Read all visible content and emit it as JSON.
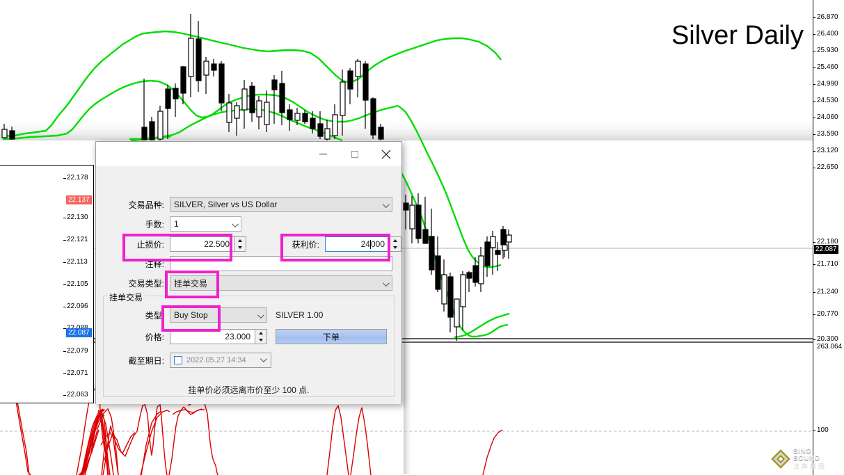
{
  "chart": {
    "title": "Silver Daily",
    "symbol_name": "SILVER",
    "current_price_label": "22.087",
    "price_scale_labels": [
      "26.870",
      "26.400",
      "25.930",
      "25.460",
      "24.990",
      "24.530",
      "24.060",
      "23.590",
      "23.120",
      "22.650",
      "22.180",
      "21.710",
      "21.240",
      "20.770",
      "20.300"
    ],
    "indicator_scale_labels": [
      "263.064",
      "100"
    ],
    "tick_panel": {
      "labels": [
        "22.178",
        "22.130",
        "22.121",
        "22.113",
        "22.105",
        "22.096",
        "22.088",
        "22.079",
        "22.071",
        "22.063"
      ],
      "ask_badge": "22.137",
      "bid_badge": "22.087",
      "ask_color": "#f4675f",
      "bid_color": "#1a72e8"
    },
    "colors": {
      "bollinger": "#00dd00",
      "oscillator": "#dd0000",
      "candle_outline": "#000000"
    }
  },
  "logo": {
    "name_en": "SINO SOUND",
    "name_cn": "汉声集团"
  },
  "dialog": {
    "title": "",
    "titlebar": {
      "minimize": "minimize",
      "maximize": "maximize",
      "close": "close"
    },
    "fields": {
      "symbol_label": "交易品种:",
      "symbol_value": "SILVER, Silver vs US Dollar",
      "volume_label": "手数:",
      "volume_value": "1",
      "stoploss_label": "止损价:",
      "stoploss_value": "22.500",
      "takeprofit_label": "获利价:",
      "takeprofit_value_pre": "24",
      "takeprofit_value_post": "000",
      "comment_label": "注释:",
      "comment_value": "",
      "ordertype_label": "交易类型:",
      "ordertype_value": "挂单交易"
    },
    "pending_group": {
      "title": "挂单交易",
      "type_label": "类型:",
      "type_value": "Buy Stop",
      "side_info": "SILVER 1.00",
      "price_label": "价格:",
      "price_value": "23.000",
      "submit_label": "下单",
      "expiry_label": "截至期日:",
      "expiry_value": "2022.05.27 14:34",
      "expiry_checked": false,
      "hint": "挂单价必须远离市价至少 100 点."
    },
    "highlight_color": "#ee22cc"
  }
}
